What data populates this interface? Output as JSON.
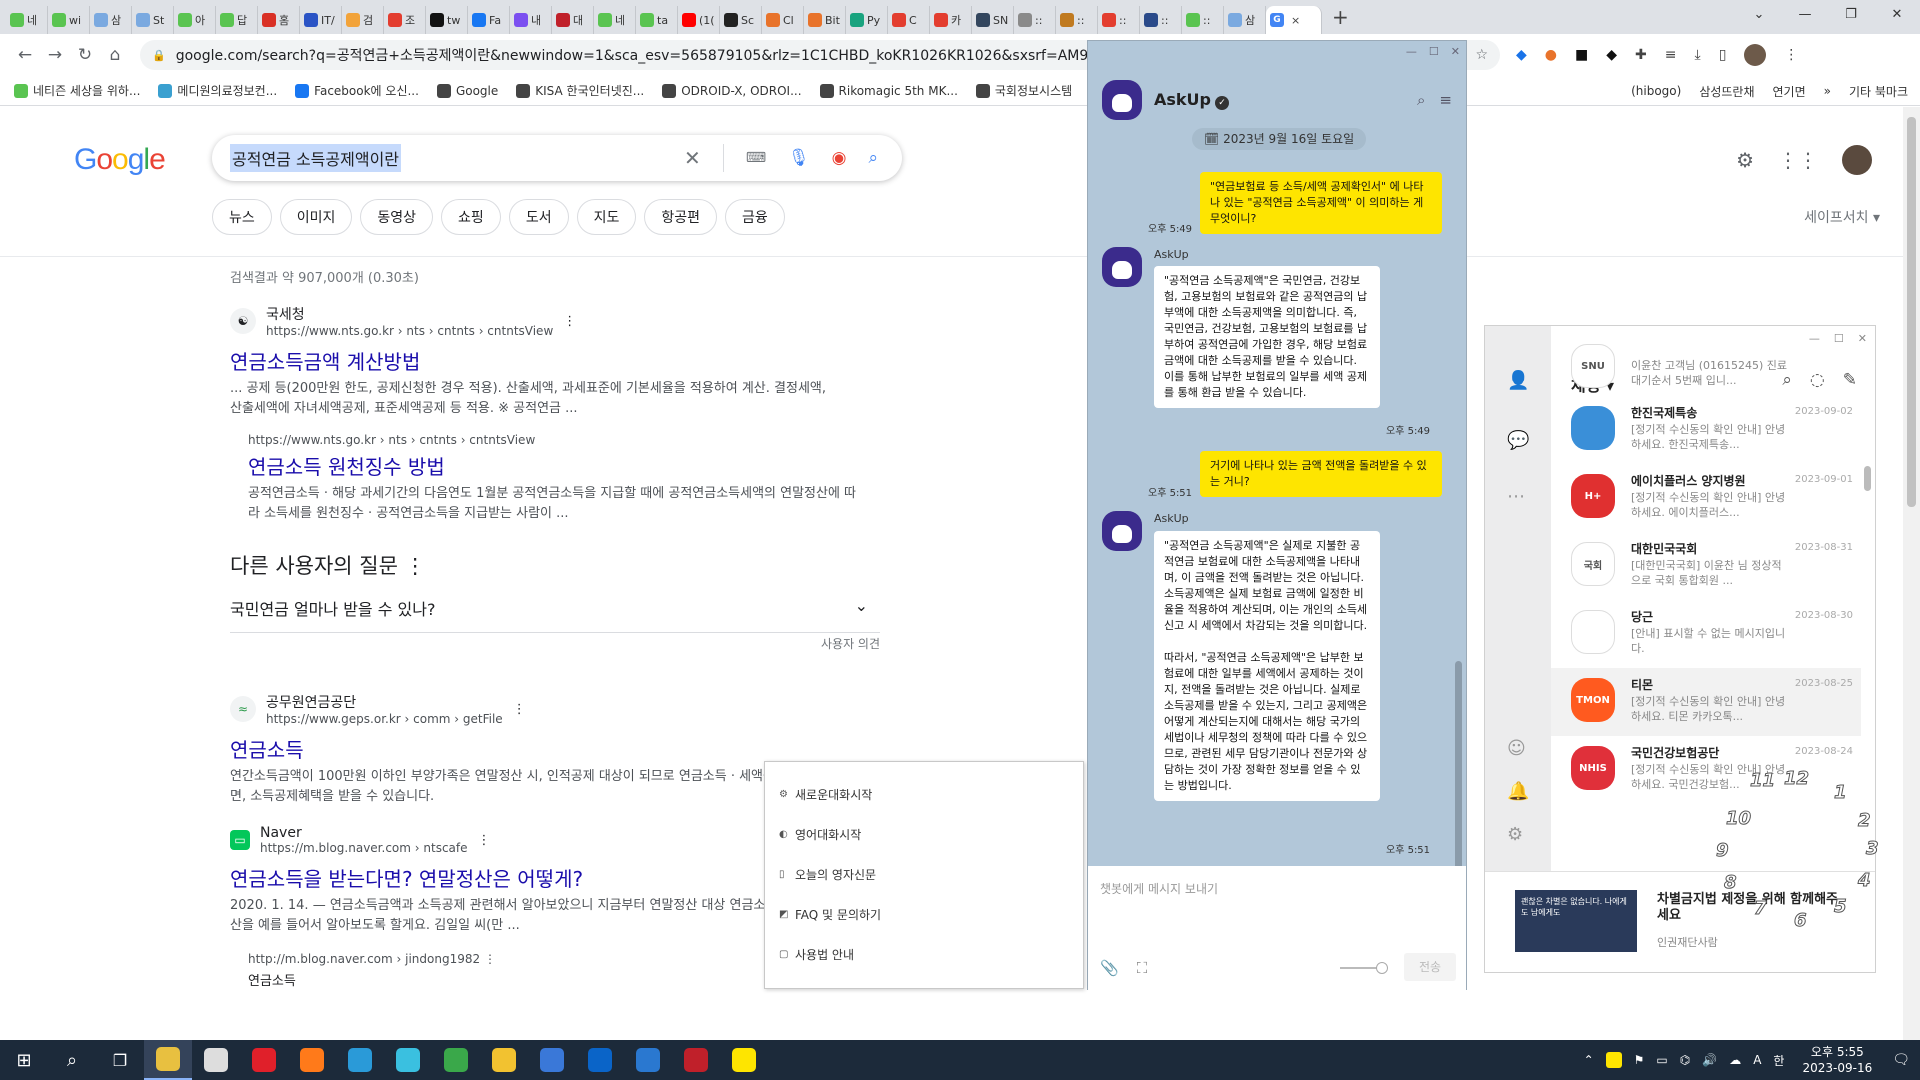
{
  "browser": {
    "tabs": [
      {
        "label": "네",
        "color": "#5ac451"
      },
      {
        "label": "wi",
        "color": "#5ac451"
      },
      {
        "label": "삼",
        "color": "#7aa9e0"
      },
      {
        "label": "St",
        "color": "#7aa9e0"
      },
      {
        "label": "아",
        "color": "#5ac451"
      },
      {
        "label": "답",
        "color": "#5ac451"
      },
      {
        "label": "홈",
        "color": "#d93025"
      },
      {
        "label": "IT/",
        "color": "#2a53c5"
      },
      {
        "label": "검",
        "color": "#f2a33a"
      },
      {
        "label": "조",
        "color": "#e33d2f"
      },
      {
        "label": "tw",
        "color": "#111111"
      },
      {
        "label": "Fa",
        "color": "#1877f2"
      },
      {
        "label": "내",
        "color": "#7b4ff0"
      },
      {
        "label": "대",
        "color": "#c0202a"
      },
      {
        "label": "네",
        "color": "#5ac451"
      },
      {
        "label": "ta",
        "color": "#5ac451"
      },
      {
        "label": "(1(",
        "color": "#ff0000"
      },
      {
        "label": "Sc",
        "color": "#222222"
      },
      {
        "label": "Cl",
        "color": "#e8732b"
      },
      {
        "label": "Bit",
        "color": "#e8732b"
      },
      {
        "label": "Py",
        "color": "#19a37f"
      },
      {
        "label": "C",
        "color": "#e33d2f"
      },
      {
        "label": "카",
        "color": "#e33d2f"
      },
      {
        "label": "SN",
        "color": "#33465e"
      },
      {
        "label": "::",
        "color": "#8a8a8a"
      },
      {
        "label": "::",
        "color": "#c07a20"
      },
      {
        "label": "::",
        "color": "#e33d2f"
      },
      {
        "label": "::",
        "color": "#2a4a8a"
      },
      {
        "label": "::",
        "color": "#5ac451"
      },
      {
        "label": "삼",
        "color": "#7aa9e0"
      }
    ],
    "active_tab": {
      "label": "G",
      "close": "×"
    },
    "new_tab": "+",
    "window_controls": [
      "⌄",
      "—",
      "❐",
      "✕"
    ],
    "url": "google.com/search?q=공적연금+소득공제액이란&newwindow=1&sca_esv=565879105&rlz=1C1CHBD_koKR1026KR1026&sxsrf=AM9HkKlelq7nA",
    "bookmarks": [
      {
        "label": "네티즌 세상을 위하...",
        "color": "#5ac451"
      },
      {
        "label": "메디원의료정보컨...",
        "color": "#3aa0d0"
      },
      {
        "label": "Facebook에 오신...",
        "color": "#1877f2"
      },
      {
        "label": "Google",
        "color": "#444444"
      },
      {
        "label": "KISA 한국인터넷진...",
        "color": "#444444"
      },
      {
        "label": "ODROID-X, ODROI...",
        "color": "#444444"
      },
      {
        "label": "Rikomagic 5th MK...",
        "color": "#444444"
      },
      {
        "label": "국회정보시스템",
        "color": "#444444"
      }
    ],
    "bookmarks_right": [
      {
        "label": "(hibogo)",
        "color": "#444444"
      },
      {
        "label": "삼성뜨란채",
        "color": "#444444"
      },
      {
        "label": "연기면",
        "color": "#2a73c5"
      },
      {
        "label": "»",
        "color": "#444444"
      },
      {
        "label": "기타 북마크",
        "color": "#f2c230"
      }
    ]
  },
  "google": {
    "query": "공적연금 소득공제액이란",
    "chips": [
      "뉴스",
      "이미지",
      "동영상",
      "쇼핑",
      "도서",
      "지도",
      "항공편",
      "금융"
    ],
    "safesearch": "세이프서치 ▾",
    "stats": "검색결과 약 907,000개 (0.30초)",
    "results": [
      {
        "site": "국세청",
        "url": "https://www.nts.go.kr › nts › cntnts › cntntsView",
        "title": "연금소득금액 계산방법",
        "snippet": "... 공제 등(200만원 한도, 공제신청한 경우 적용). 산출세액, 과세표준에 기본세율을 적용하여 계산. 결정세액, 산출세액에 자녀세액공제, 표준세액공제 등 적용. ※ 공적연금 ...",
        "sub": {
          "url": "https://www.nts.go.kr › nts › cntnts › cntntsView",
          "title": "연금소득 원천징수 방법",
          "snippet": "공적연금소득 · 해당 과세기간의 다음연도 1월분 공적연금소득을 지급할 때에 공적연금소득세액의 연말정산에 따라 소득세를 원천징수 · 공적연금소득을 지급받는 사람이 ..."
        }
      }
    ],
    "paa": {
      "heading": "다른 사용자의 질문",
      "question": "국민연금 얼마나 받을 수 있나?",
      "feedback": "사용자 의견"
    },
    "results2": [
      {
        "site": "공무원연금공단",
        "url": "https://www.geps.or.kr › comm › getFile",
        "title": "연금소득",
        "snippet": "연간소득금액이 100만원 이하인 부양가족은 연말정산 시, 인적공제 대상이 되므로 연금소득 · 세액공제를 신고하면, 소득공제혜택을 받을 수 있습니다."
      },
      {
        "site": "Naver",
        "url": "https://m.blog.naver.com › ntscafe",
        "title": "연금소득을 받는다면? 연말정산은 어떻게?",
        "snippet": "2020. 1. 14. — 연금소득금액과 소득공제 관련해서 알아보았으니 지금부터 연말정산 대상 연금소득의 연말정산을 예를 들어서 알아보도록 할게요. 김일일 씨(만 ..."
      }
    ],
    "last_url": "http://m.blog.naver.com › jindong1982",
    "last_title": "연금소득"
  },
  "askup": {
    "name": "AskUp",
    "date": "2023년 9월 16일 토요일",
    "input_placeholder": "챗봇에게 메시지 보내기",
    "send": "전송",
    "messages": [
      {
        "who": "me",
        "text": "\"연금보험료 등 소득/세액 공제확인서\" 에 나타나 있는 \"공적연금 소득공제액\" 이 의미하는 게 무엇이니?",
        "time": "오후 5:49"
      },
      {
        "who": "bot",
        "name": "AskUp",
        "text": "\"공적연금 소득공제액\"은 국민연금, 건강보험, 고용보험의 보험료와 같은 공적연금의 납부액에 대한 소득공제액을 의미합니다. 즉, 국민연금, 건강보험, 고용보험의 보험료를 납부하여 공적연금에 가입한 경우, 해당 보험료 금액에 대한 소득공제를 받을 수 있습니다. 이를 통해 납부한 보험료의 일부를 세액 공제를 통해 환급 받을 수 있습니다.",
        "time": "오후 5:49"
      },
      {
        "who": "me",
        "text": "거기에 나타나 있는 금액 전액을 돌려받을 수 있는 거니?",
        "time": "오후 5:51"
      },
      {
        "who": "bot",
        "name": "AskUp",
        "text": "\"공적연금 소득공제액\"은 실제로 지불한 공적연금 보험료에 대한 소득공제액을 나타내며, 이 금액을 전액 돌려받는 것은 아닙니다. 소득공제액은 실제 보험료 금액에 일정한 비율을 적용하여 계산되며, 이는 개인의 소득세 신고 시 세액에서 차감되는 것을 의미합니다.\n\n따라서, \"공적연금 소득공제액\"은 납부한 보험료에 대한 일부를 세액에서 공제하는 것이지, 전액을 돌려받는 것은 아닙니다. 실제로 소득공제를 받을 수 있는지, 그리고 공제액은 어떻게 계산되는지에 대해서는 해당 국가의 세법이나 세무청의 정책에 따라 다를 수 있으므로, 관련된 세무 담당기관이나 전문가와 상담하는 것이 가장 정확한 정보를 얻을 수 있는 방법입니다.",
        "time": "오후 5:51"
      }
    ]
  },
  "context_menu": {
    "items": [
      {
        "icon": "⚙",
        "label": "새로운대화시작"
      },
      {
        "icon": "◐",
        "label": "영어대화시작"
      },
      {
        "icon": "▯",
        "label": "오늘의 영자신문"
      },
      {
        "icon": "◩",
        "label": "FAQ 및 문의하기"
      },
      {
        "icon": "▢",
        "label": "사용법 안내"
      }
    ]
  },
  "kakao": {
    "title": "채팅 ▾",
    "rooms": [
      {
        "name": "",
        "date": "",
        "preview": "이윤찬 고객님 (01615245) 진료 대기순서 5번째 입니...",
        "color": "#ffffff",
        "avatar_text": "SNU"
      },
      {
        "name": "한진국제특송",
        "date": "2023-09-02",
        "preview": "[정기적 수신동의 확인 안내] 안녕하세요. 한진국제특송...",
        "color": "#3a8fd8",
        "avatar_text": ""
      },
      {
        "name": "에이치플러스 양지병원",
        "date": "2023-09-01",
        "preview": "[정기적 수신동의 확인 안내] 안녕하세요. 에이치플러스...",
        "color": "#e03030",
        "avatar_text": "H+"
      },
      {
        "name": "대한민국국회",
        "date": "2023-08-31",
        "preview": "[대한민국국회] 이윤찬 님 정상적으로 국회 통합회원 ...",
        "color": "#ffffff",
        "avatar_text": "국회"
      },
      {
        "name": "당근",
        "date": "2023-08-30",
        "preview": "[안내] 표시할 수 없는 메시지입니다.",
        "color": "#ffffff",
        "avatar_text": ""
      },
      {
        "name": "티몬",
        "date": "2023-08-25",
        "preview": "[정기적 수신동의 확인 안내] 안녕하세요. 티몬 카카오톡...",
        "color": "#ff5a1f",
        "avatar_text": "TMON"
      },
      {
        "name": "국민건강보험공단",
        "date": "2023-08-24",
        "preview": "[정기적 수신동의 확인 안내] 안녕하세요. 국민건강보험...",
        "color": "#e0303a",
        "avatar_text": "NHIS"
      }
    ],
    "ad_title": "차별금지법 제정을 위해 함께해주세요",
    "ad_sponsor": "인권재단사람",
    "ad_image_text": "괜찮은 차별은 없습니다. 나에게도 남에게도"
  },
  "clock_overlay": [
    "11",
    "12",
    "1",
    "2",
    "3",
    "4",
    "5",
    "6",
    "7",
    "8",
    "9",
    "10"
  ],
  "taskbar": {
    "apps": [
      {
        "name": "start",
        "color": "#ffffff"
      },
      {
        "name": "search",
        "color": "#ffffff"
      },
      {
        "name": "taskview",
        "color": "#ffffff"
      },
      {
        "name": "app-pen",
        "color": "#e8c040"
      },
      {
        "name": "clock-app",
        "color": "#dddddd"
      },
      {
        "name": "opera",
        "color": "#e0202a"
      },
      {
        "name": "firefox",
        "color": "#ff7a1a"
      },
      {
        "name": "edge",
        "color": "#2a9ad8"
      },
      {
        "name": "bird-app",
        "color": "#3ac0e0"
      },
      {
        "name": "chrome",
        "color": "#3aa84a"
      },
      {
        "name": "explorer",
        "color": "#f2c230"
      },
      {
        "name": "store",
        "color": "#3a78d8"
      },
      {
        "name": "outlook",
        "color": "#0a64c8"
      },
      {
        "name": "mail",
        "color": "#2a78d0"
      },
      {
        "name": "filezilla",
        "color": "#c0202a"
      },
      {
        "name": "kakaotalk",
        "color": "#fee500"
      }
    ],
    "time": "오후 5:55",
    "date": "2023-09-16",
    "ime": "A",
    "lang": "한"
  }
}
